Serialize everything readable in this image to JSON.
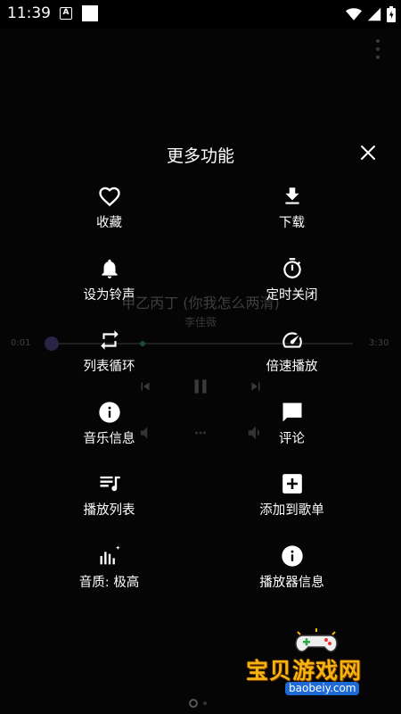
{
  "status_bar": {
    "time": "11:39",
    "notification_letter": "A",
    "icons": [
      "wifi-icon",
      "signal-icon",
      "battery-icon"
    ]
  },
  "player": {
    "song_title": "甲乙丙丁 (你我怎么两清)",
    "artist": "李佳薇",
    "current_time": "0:01",
    "total_time": "3:30",
    "progress": 0.005
  },
  "menu": {
    "title": "更多功能",
    "items": [
      {
        "label": "收藏",
        "icon": "heart-icon"
      },
      {
        "label": "下载",
        "icon": "download-icon"
      },
      {
        "label": "设为铃声",
        "icon": "bell-icon"
      },
      {
        "label": "定时关闭",
        "icon": "timer-icon"
      },
      {
        "label": "列表循环",
        "icon": "repeat-icon"
      },
      {
        "label": "倍速播放",
        "icon": "speed-gauge-icon"
      },
      {
        "label": "音乐信息",
        "icon": "info-icon"
      },
      {
        "label": "评论",
        "icon": "comment-icon"
      },
      {
        "label": "播放列表",
        "icon": "playlist-icon"
      },
      {
        "label": "添加到歌单",
        "icon": "add-box-icon"
      },
      {
        "label": "音质: 极高",
        "icon": "quality-bars-icon"
      },
      {
        "label": "播放器信息",
        "icon": "info-icon"
      }
    ]
  },
  "watermark": {
    "text": "宝贝游戏网",
    "url": "baobeiy.com"
  },
  "colors": {
    "background": "#050505",
    "text": "#ffffff",
    "watermark": "#f5b40f",
    "watermark_url_bg": "#1d6ad6"
  }
}
